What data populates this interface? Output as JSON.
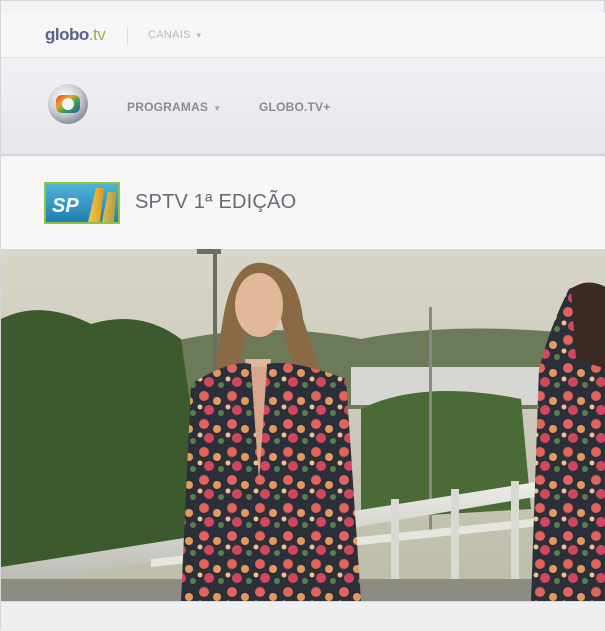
{
  "topbar": {
    "brand_main": "globo",
    "brand_suffix": ".tv",
    "canais_label": "CANAIS"
  },
  "navbar": {
    "programas_label": "PROGRAMAS",
    "globotv_plus_label": "GLOBO.TV+"
  },
  "program": {
    "title": "SPTV 1ª EDIÇÃO",
    "logo_text": "SP"
  },
  "colors": {
    "brand_purple": "#5a5f8c",
    "brand_green": "#9bb04a",
    "nav_text": "#8a8a94"
  },
  "icons": {
    "globo_logo": "globo-logo-icon",
    "sp_logo": "sptv-logo-icon",
    "dropdown": "chevron-down-icon"
  }
}
